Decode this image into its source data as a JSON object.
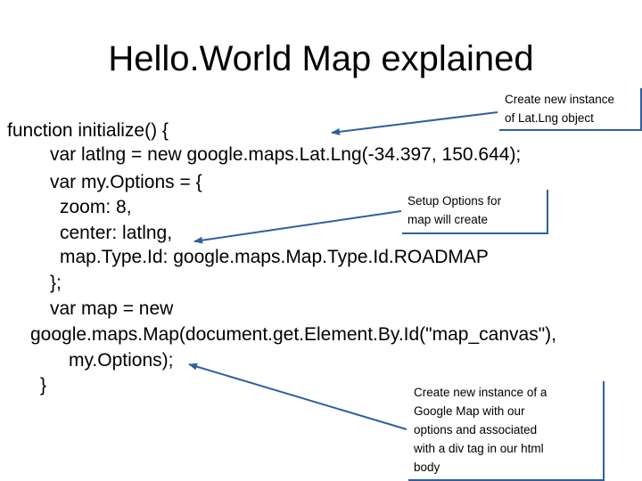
{
  "title": "Hello.World Map explained",
  "code": [
    "function initialize() {",
    "var latlng = new google.maps.Lat.Lng(-34.397, 150.644);",
    "var my.Options = {",
    "zoom: 8,",
    "center: latlng,",
    "map.Type.Id: google.maps.Map.Type.Id.ROADMAP",
    "};",
    "var map = new",
    "google.maps.Map(document.get.Element.By.Id(\"map_canvas\"),",
    "my.Options);",
    "}"
  ],
  "callouts": {
    "latlng": [
      "Create new instance",
      "of Lat.Lng object"
    ],
    "options": [
      "Setup Options for",
      "map will create"
    ],
    "map": [
      "Create new instance of a",
      "Google Map with our",
      "options and associated",
      "with a div tag in our html",
      "body"
    ]
  },
  "colors": {
    "arrow": "#2f5f9f",
    "callout_border": "#2f5f9f"
  }
}
